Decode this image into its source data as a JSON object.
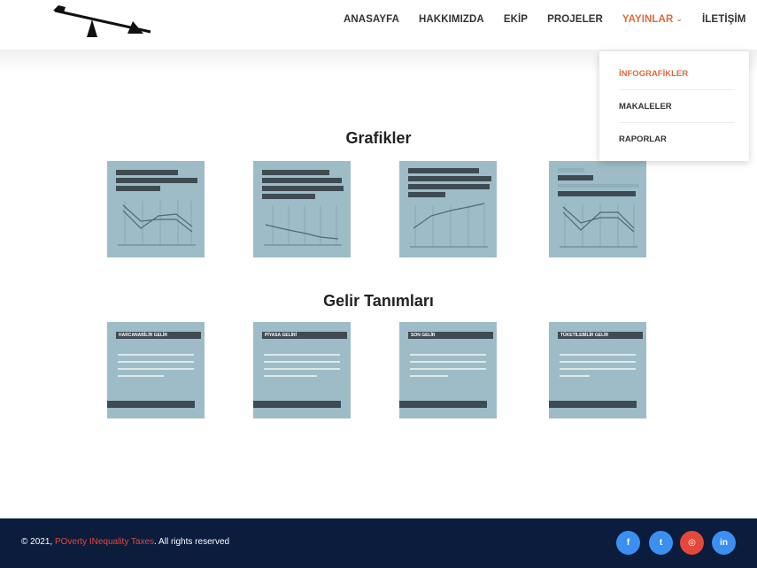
{
  "nav": {
    "items": [
      {
        "label": "ANASAYFA"
      },
      {
        "label": "HAKKIMIZDA"
      },
      {
        "label": "EKİP"
      },
      {
        "label": "PROJELER"
      },
      {
        "label": "YAYINLAR"
      },
      {
        "label": "İLETİŞİM"
      }
    ],
    "active": "YAYINLAR"
  },
  "dropdown": {
    "items": [
      {
        "label": "İNFOGRAFİKLER"
      },
      {
        "label": "MAKALELER"
      },
      {
        "label": "RAPORLAR"
      }
    ],
    "active": "İNFOGRAFİKLER"
  },
  "sections": {
    "grafikler_title": "Grafikler",
    "gelir_title": "Gelir Tanımları"
  },
  "income_cards": [
    {
      "title": "HARCANABİLİR GELİR"
    },
    {
      "title": "PİYASA GELİRİ"
    },
    {
      "title": "SON GELİR"
    },
    {
      "title": "TÜKETİLEBİLİR GELİR"
    }
  ],
  "footer": {
    "copyright_prefix": "© 2021,",
    "brand": "POverty INequality Taxes",
    "suffix": ". All rights reserved",
    "social": [
      {
        "icon": "facebook-icon",
        "glyph": "f",
        "color": "#3b8ff0"
      },
      {
        "icon": "twitter-icon",
        "glyph": "t",
        "color": "#3b8ff0"
      },
      {
        "icon": "instagram-icon",
        "glyph": "◎",
        "color": "#e4483a"
      },
      {
        "icon": "linkedin-icon",
        "glyph": "in",
        "color": "#3b8ff0"
      }
    ]
  },
  "colors": {
    "accent": "#e06a3b",
    "card": "#9dbcc7",
    "footer": "#0b1c3d"
  }
}
